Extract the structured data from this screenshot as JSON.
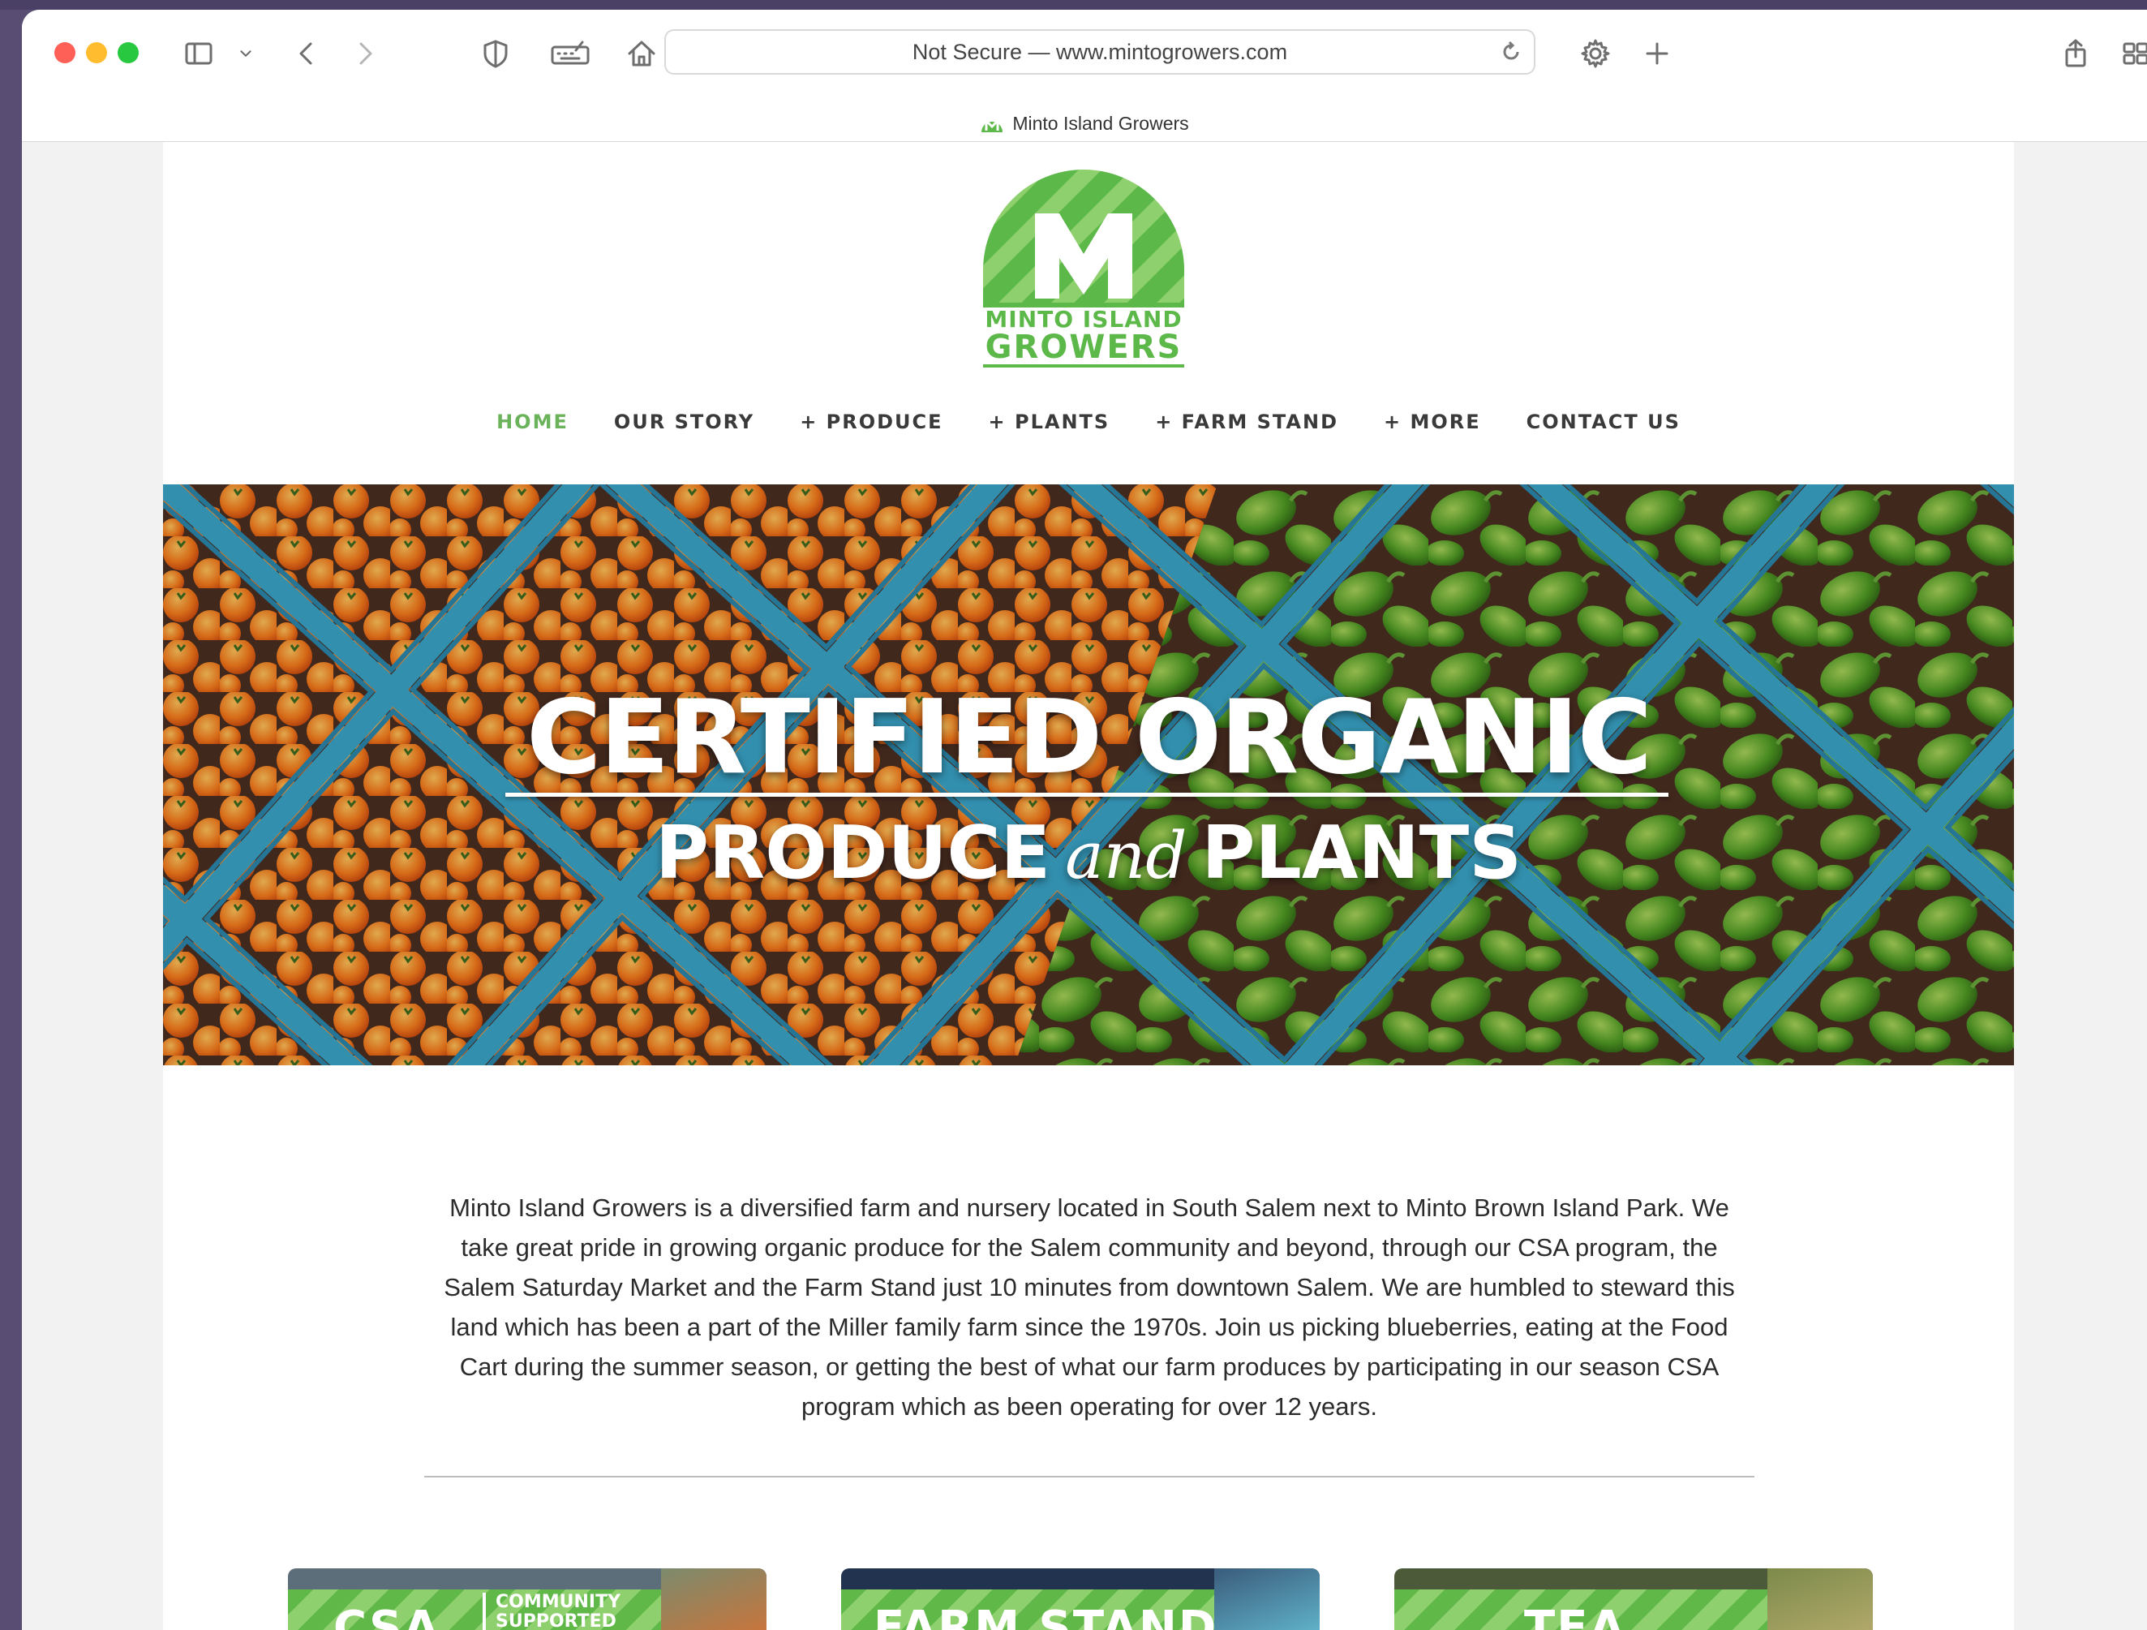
{
  "browser": {
    "address_text": "Not Secure — www.mintogrowers.com",
    "tab_title": "Minto Island Growers"
  },
  "site": {
    "logo_line1": "MINTO ISLAND",
    "logo_line2": "GROWERS",
    "brand_green": "#5cb848",
    "nav": {
      "home": "HOME",
      "our_story": "OUR STORY",
      "produce": "+ PRODUCE",
      "plants": "+ PLANTS",
      "farm_stand": "+ FARM STAND",
      "more": "+ MORE",
      "contact": "CONTACT US"
    },
    "hero": {
      "headline": "CERTIFIED ORGANIC",
      "sub_left": "PRODUCE",
      "sub_script": "and",
      "sub_right": "PLANTS"
    },
    "intro": "Minto Island Growers is a diversified farm and nursery located in South Salem next to Minto Brown Island Park. We take great pride in growing organic produce for the Salem community and beyond, through our CSA program, the Salem Saturday Market and the Farm Stand just 10 minutes from downtown Salem. We are humbled to steward this land which has been a part of the Miller family farm since the 1970s. Join us picking blueberries, eating at the Food Cart during the summer season, or getting the best of what our farm produces by participating in our season CSA program which as been operating for over 12 years.",
    "cards": {
      "csa_title": "CSA",
      "csa_sub1": "COMMUNITY",
      "csa_sub2": "SUPPORTED",
      "farm_stand_title": "FARM STAND",
      "tea_title": "TEA"
    }
  }
}
